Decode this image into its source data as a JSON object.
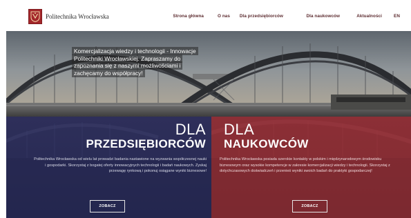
{
  "header": {
    "logo_text": "Politechnika Wrocławska",
    "nav": [
      {
        "label": "Strona główna",
        "id": "nav-strona-glowna"
      },
      {
        "label": "O nas",
        "id": "nav-o-nas"
      },
      {
        "label": "Dla przedsiębiorców",
        "id": "nav-dla-przedsiebiorcow"
      },
      {
        "label": "Dla naukowców",
        "id": "nav-dla-naukowcow"
      },
      {
        "label": "Aktualności",
        "id": "nav-aktualnosci"
      },
      {
        "label": "EN",
        "id": "nav-en"
      }
    ]
  },
  "hero": {
    "caption": "Komercjalizacja wiedzy i technologii - Innowacje Politechniki Wrocławskiej. Zapraszamy do zapoznania się z naszymi możliwościami i zachęcamy do współpracy!"
  },
  "panels": {
    "left": {
      "dla": "DLA",
      "heading": "PRZEDSIĘBIORCÓW",
      "description": "Politechnika Wrocławska od wielu lat prowadzi badania nastawione na wyzwania współczesnej nauki i gospodarki. Skorzystaj z bogatej oferty innowacyjnych technologii i badań naukowych. Zyskaj przewagę rynkową i pokonuj osiągane wyniki biznesowe!",
      "button": "ZOBACZ"
    },
    "right": {
      "dla": "DLA",
      "heading": "NAUKOWCÓW",
      "description": "Politechnika Wrocławska posiada szerokie kontakty w polskim i międzynarodowym środowisku biznesowym oraz wysokie kompetencje w zakresie komercjalizacji wiedzy i technologii. Skorzystaj z dotychczasowych doświadczeń i przenieś wyniki swoich badań do praktyki gospodarczej!",
      "button": "ZOBACZ"
    }
  },
  "colors": {
    "brand_red": "#a3262a",
    "panel_navy": "#2a2c55",
    "panel_red": "#872d34",
    "nav_text": "#5b2a2e"
  },
  "icons": {
    "logo": "university-crest-icon"
  }
}
